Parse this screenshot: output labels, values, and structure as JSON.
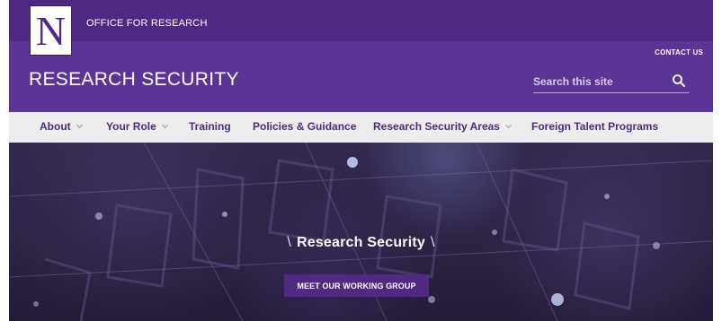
{
  "topbar": {
    "logo_letter": "N",
    "office_link": "OFFICE FOR RESEARCH",
    "brand_color": "#4e2a84"
  },
  "header": {
    "contact_link": "CONTACT US",
    "site_title": "RESEARCH SECURITY",
    "search": {
      "placeholder": "Search this site",
      "value": "",
      "icon": "search-icon"
    },
    "background_color": "#5b3596"
  },
  "nav": {
    "items": [
      {
        "label": "About",
        "has_dropdown": true
      },
      {
        "label": "Your Role",
        "has_dropdown": true
      },
      {
        "label": "Training",
        "has_dropdown": false
      },
      {
        "label": "Policies & Guidance",
        "has_dropdown": false
      },
      {
        "label": "Research Security Areas",
        "has_dropdown": true
      },
      {
        "label": "Foreign Talent Programs",
        "has_dropdown": false
      }
    ],
    "background_color": "#ededed",
    "text_color": "#4e2a84"
  },
  "hero": {
    "title": "Research Security",
    "slash_left": "\\",
    "slash_right": "\\",
    "button_label": "MEET OUR WORKING GROUP",
    "button_color": "#4e2a84"
  }
}
